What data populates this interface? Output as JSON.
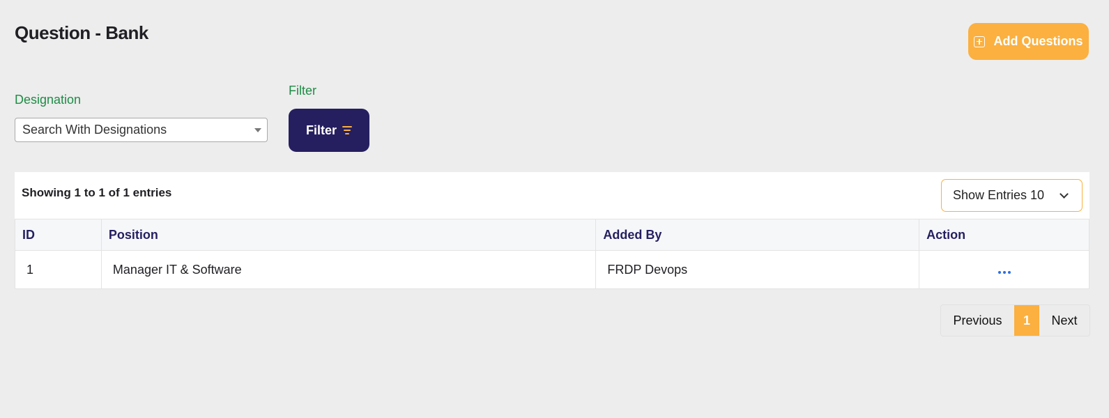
{
  "header": {
    "title": "Question - Bank",
    "add_button_label": "Add Questions",
    "add_icon": "plus-square-icon"
  },
  "filters": {
    "designation_label": "Designation",
    "designation_placeholder": "Search With Designations",
    "filter_label": "Filter",
    "filter_button_label": "Filter",
    "filter_icon": "filter-lines-icon"
  },
  "table": {
    "showing_text": "Showing 1 to 1 of 1 entries",
    "entries_select_label": "Show Entries 10",
    "columns": [
      "ID",
      "Position",
      "Added By",
      "Action"
    ],
    "rows": [
      {
        "id": "1",
        "position": "Manager IT & Software",
        "added_by": "FRDP Devops",
        "action_icon": "more-horizontal-icon"
      }
    ]
  },
  "pagination": {
    "previous_label": "Previous",
    "current_page": "1",
    "next_label": "Next"
  },
  "colors": {
    "background": "#ededed",
    "accent_orange": "#fbb040",
    "primary_navy": "#251f60",
    "label_green": "#1e8c46",
    "action_blue": "#2f6ee0"
  }
}
